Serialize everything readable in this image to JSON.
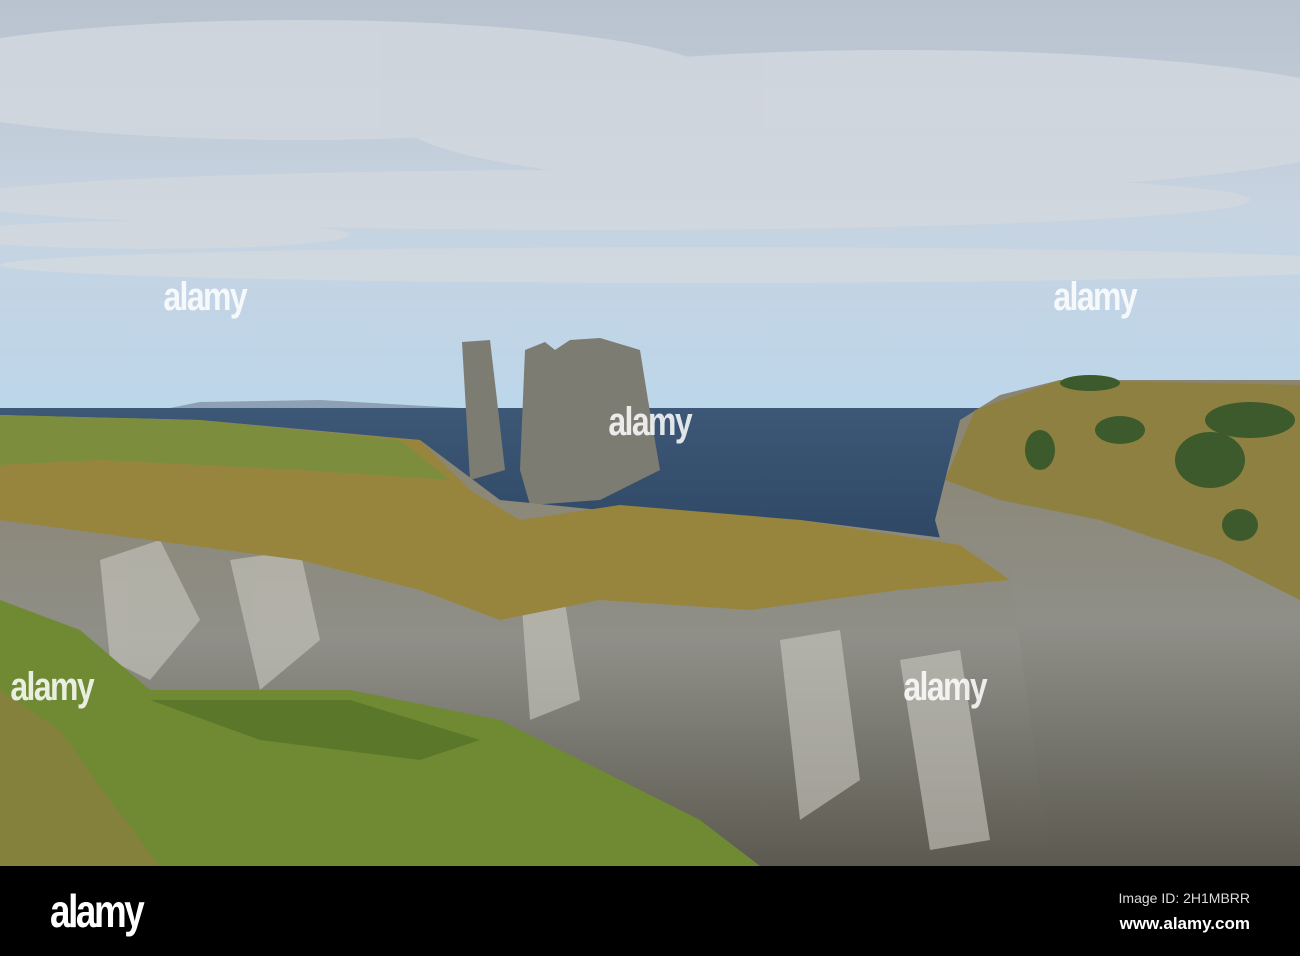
{
  "watermark": {
    "brand": "alamy"
  },
  "footer": {
    "logo": "alamy",
    "image_id": "Image ID: 2H1MBRR",
    "website": "www.alamy.com"
  }
}
